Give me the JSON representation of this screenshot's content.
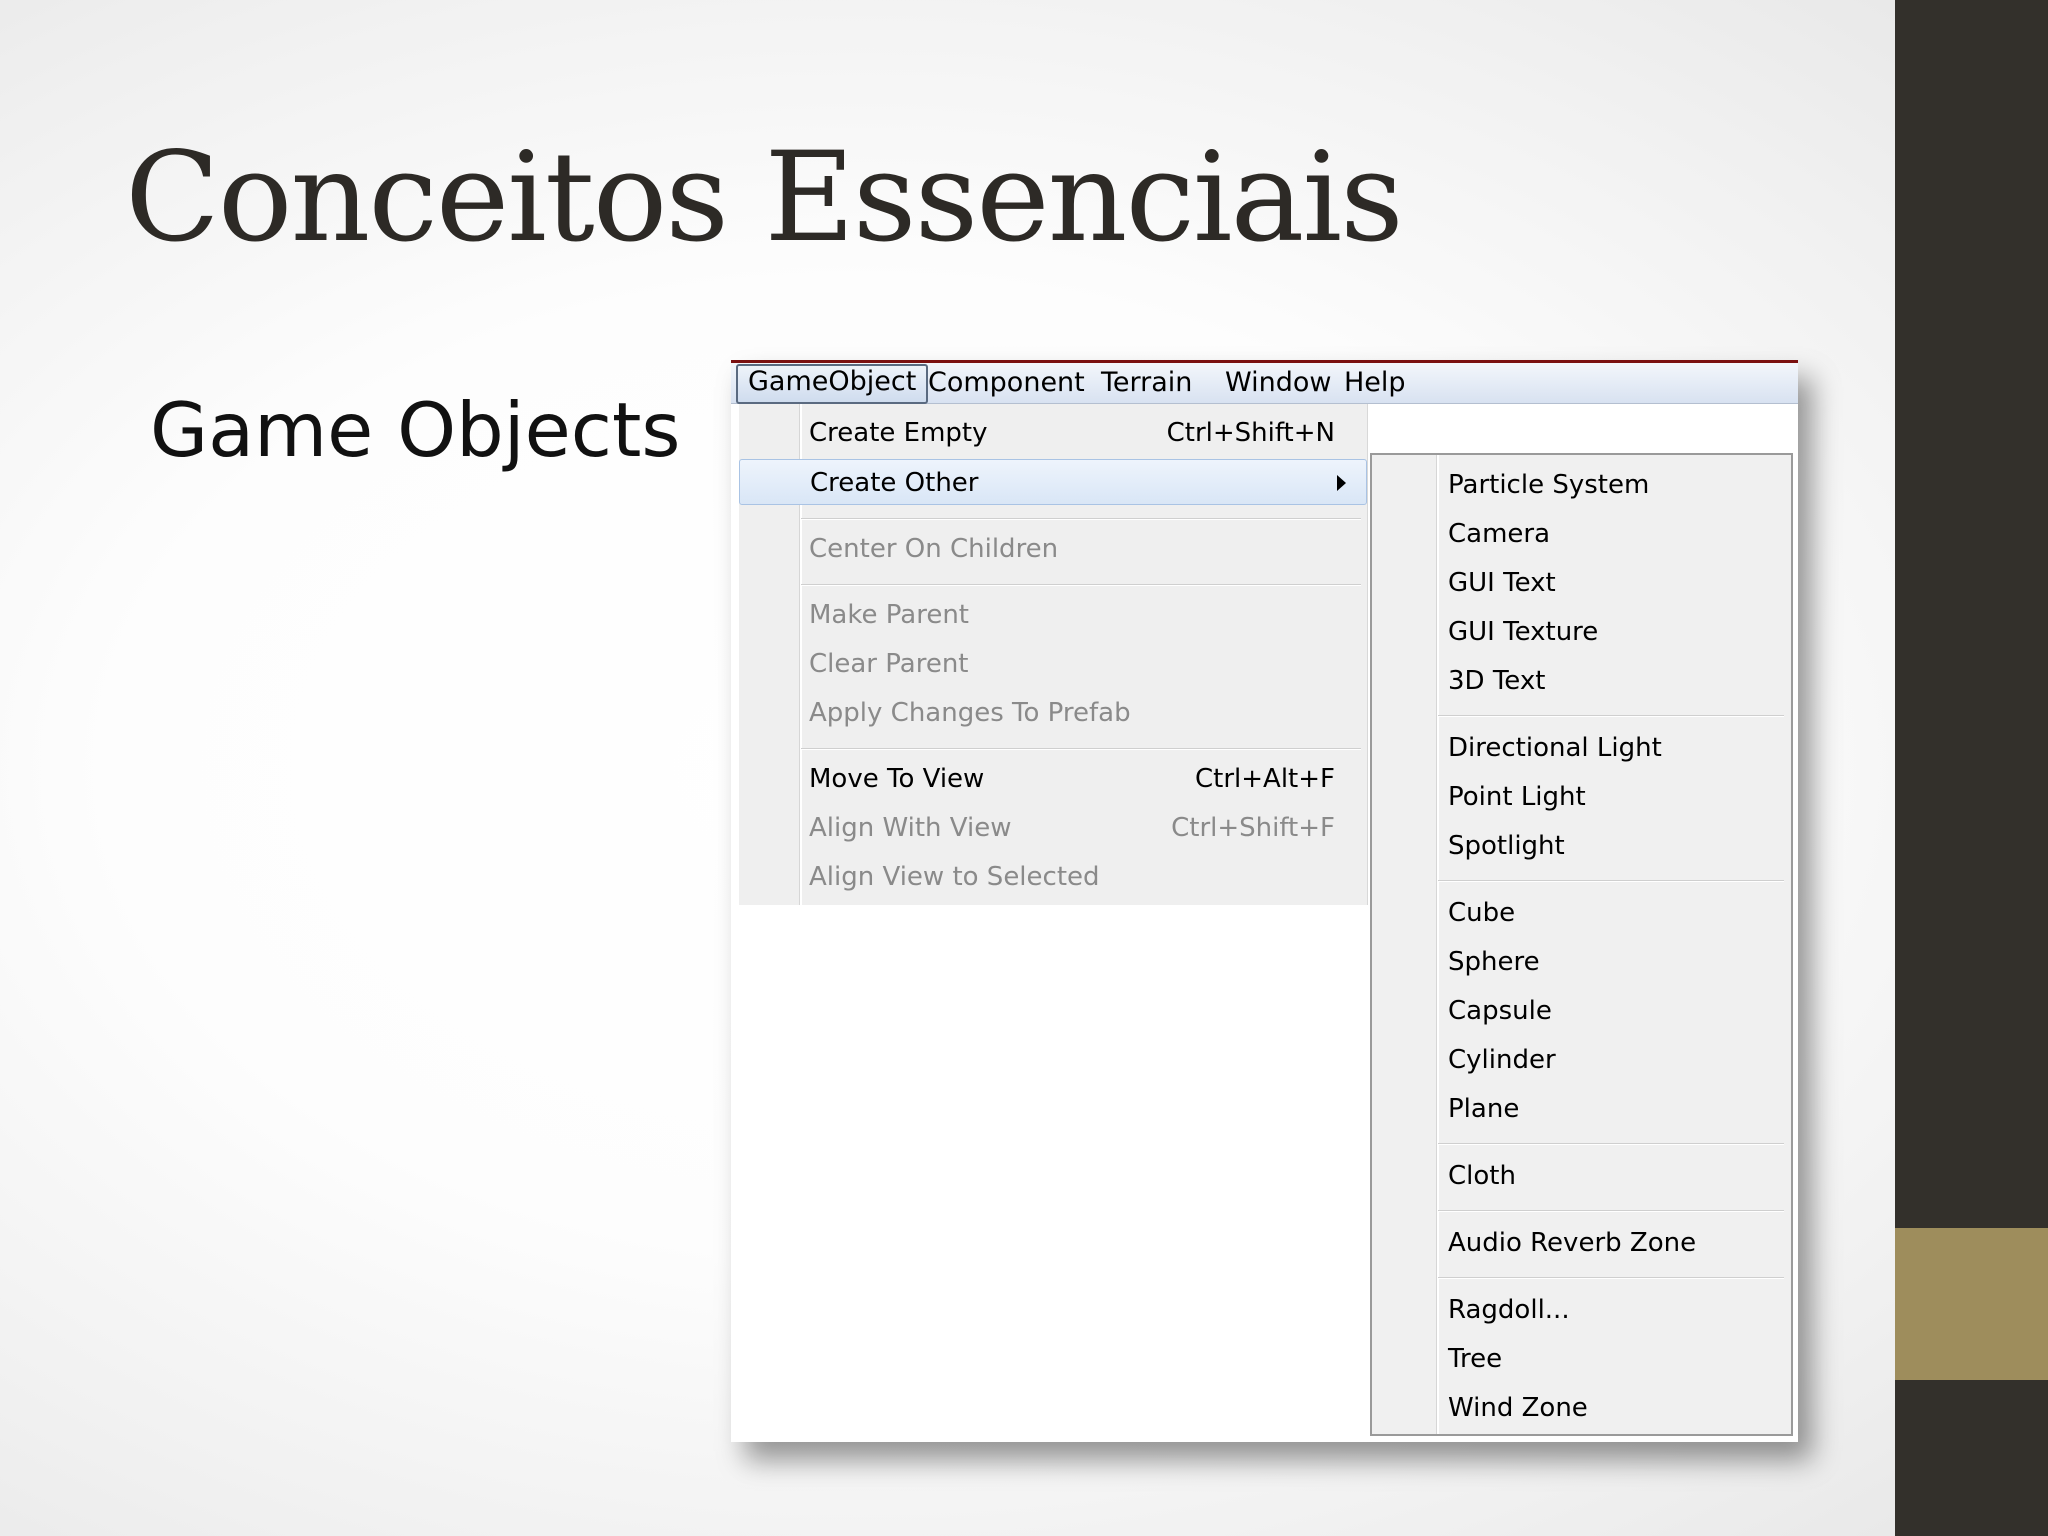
{
  "slide": {
    "title": "Conceitos Essenciais",
    "bullet": "Game Objects",
    "colors": {
      "sidebar": "#33302b",
      "accent": "#9e8d5c",
      "title": "#2d2a26"
    }
  },
  "menubar": {
    "items": [
      "GameObject",
      "Component",
      "Terrain",
      "Window",
      "Help"
    ],
    "active": "GameObject"
  },
  "gameobject_menu": {
    "create_empty": {
      "label": "Create Empty",
      "shortcut": "Ctrl+Shift+N"
    },
    "create_other": {
      "label": "Create Other"
    },
    "center_on_children": {
      "label": "Center On Children"
    },
    "make_parent": {
      "label": "Make Parent"
    },
    "clear_parent": {
      "label": "Clear Parent"
    },
    "apply_changes": {
      "label": "Apply Changes To Prefab"
    },
    "move_to_view": {
      "label": "Move To View",
      "shortcut": "Ctrl+Alt+F"
    },
    "align_with_view": {
      "label": "Align With View",
      "shortcut": "Ctrl+Shift+F"
    },
    "align_view_to_selected": {
      "label": "Align View to Selected"
    }
  },
  "create_other_submenu": {
    "items": [
      "Particle System",
      "Camera",
      "GUI Text",
      "GUI Texture",
      "3D Text",
      "Directional Light",
      "Point Light",
      "Spotlight",
      "Cube",
      "Sphere",
      "Capsule",
      "Cylinder",
      "Plane",
      "Cloth",
      "Audio Reverb Zone",
      "Ragdoll...",
      "Tree",
      "Wind Zone"
    ]
  }
}
